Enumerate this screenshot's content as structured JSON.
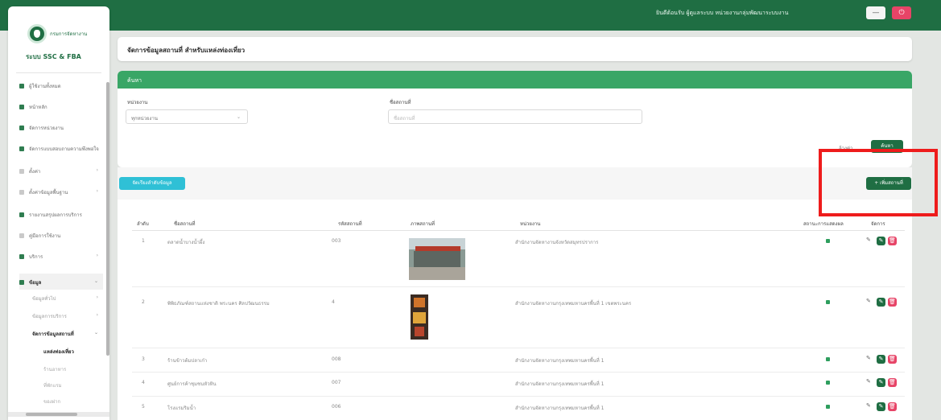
{
  "topbar": {
    "user_text": "ยินดีต้อนรับ ผู้ดูแลระบบ หน่วยงานกลุ่มพัฒนาระบบงาน",
    "minimize_label": "—",
    "logout_label": "⏻"
  },
  "sidebar": {
    "logo_name": "กรมการจัดหางาน",
    "logo_sub": "ระบบ SSC & FBA",
    "items": [
      {
        "label": "ผู้ใช้งานทั้งหมด"
      },
      {
        "label": "หน้าหลัก"
      },
      {
        "label": "จัดการหน่วยงาน"
      },
      {
        "label": "จัดการแบบสอบถามความพึงพอใจ"
      },
      {
        "label": "ตั้งค่า"
      },
      {
        "label": "ตั้งค่าข้อมูลพื้นฐาน"
      },
      {
        "label": "รายงานสรุปผลการบริการ"
      },
      {
        "label": "คู่มือการใช้งาน"
      },
      {
        "label": "บริการ"
      },
      {
        "label": "ข้อมูล"
      }
    ],
    "sub_items": [
      {
        "label": "ข้อมูลทั่วไป"
      },
      {
        "label": "ข้อมูลการบริการ"
      },
      {
        "label": "จัดการข้อมูลสถานที่"
      }
    ],
    "sub_sub_items": [
      {
        "label": "แหล่งท่องเที่ยว"
      },
      {
        "label": "ร้านอาหาร"
      },
      {
        "label": "ที่พักแรม"
      },
      {
        "label": "ของฝาก"
      }
    ]
  },
  "page": {
    "title": "จัดการข้อมูลสถานที่ สำหรับแหล่งท่องเที่ยว"
  },
  "search": {
    "header": "ค้นหา",
    "unit_label": "หน่วยงาน",
    "unit_value": "ทุกหน่วยงาน",
    "name_label": "ชื่อสถานที่",
    "name_placeholder": "ชื่อสถานที่",
    "clear_label": "ล้างค่า",
    "search_button": "ค้นหา"
  },
  "toolbar": {
    "order_button": "จัดเรียงลำดับข้อมูล",
    "add_button": "+ เพิ่มสถานที่"
  },
  "table": {
    "headers": [
      "ลำดับ",
      "ชื่อสถานที่",
      "รหัสสถานที่",
      "ภาพสถานที่",
      "หน่วยงาน",
      "สถานะการแสดงผล",
      "จัดการ"
    ],
    "rows": [
      {
        "no": "1",
        "name": "ตลาดน้ำบางน้ำผึ้ง",
        "code": "003",
        "unit": "สำนักงานจัดหางานจังหวัดสมุทรปราการ"
      },
      {
        "no": "2",
        "name": "พิพิธภัณฑ์สถานแห่งชาติ พระนคร ศิลปวัฒนธรรม",
        "code": "4",
        "unit": "สำนักงานจัดหางานกรุงเทพมหานครพื้นที่ 1 เขตพระนคร"
      },
      {
        "no": "3",
        "name": "ร้านข้าวต้มปลาเก๋า",
        "code": "008",
        "unit": "สำนักงานจัดหางานกรุงเทพมหานครพื้นที่ 1"
      },
      {
        "no": "4",
        "name": "ศูนย์การค้าชุมชนหัวหิน",
        "code": "007",
        "unit": "สำนักงานจัดหางานกรุงเทพมหานครพื้นที่ 1"
      },
      {
        "no": "5",
        "name": "โรงแรมริมน้ำ",
        "code": "006",
        "unit": "สำนักงานจัดหางานกรุงเทพมหานครพื้นที่ 1"
      }
    ],
    "view_icon": "✎",
    "edit_icon": "✎",
    "delete_icon": "🗑"
  },
  "colors": {
    "brand_green": "#1f6e43",
    "search_header_green": "#39a666",
    "cyan_button": "#2fc0d6",
    "delete_red": "#e74467",
    "highlight_red": "#ee1c1c"
  }
}
